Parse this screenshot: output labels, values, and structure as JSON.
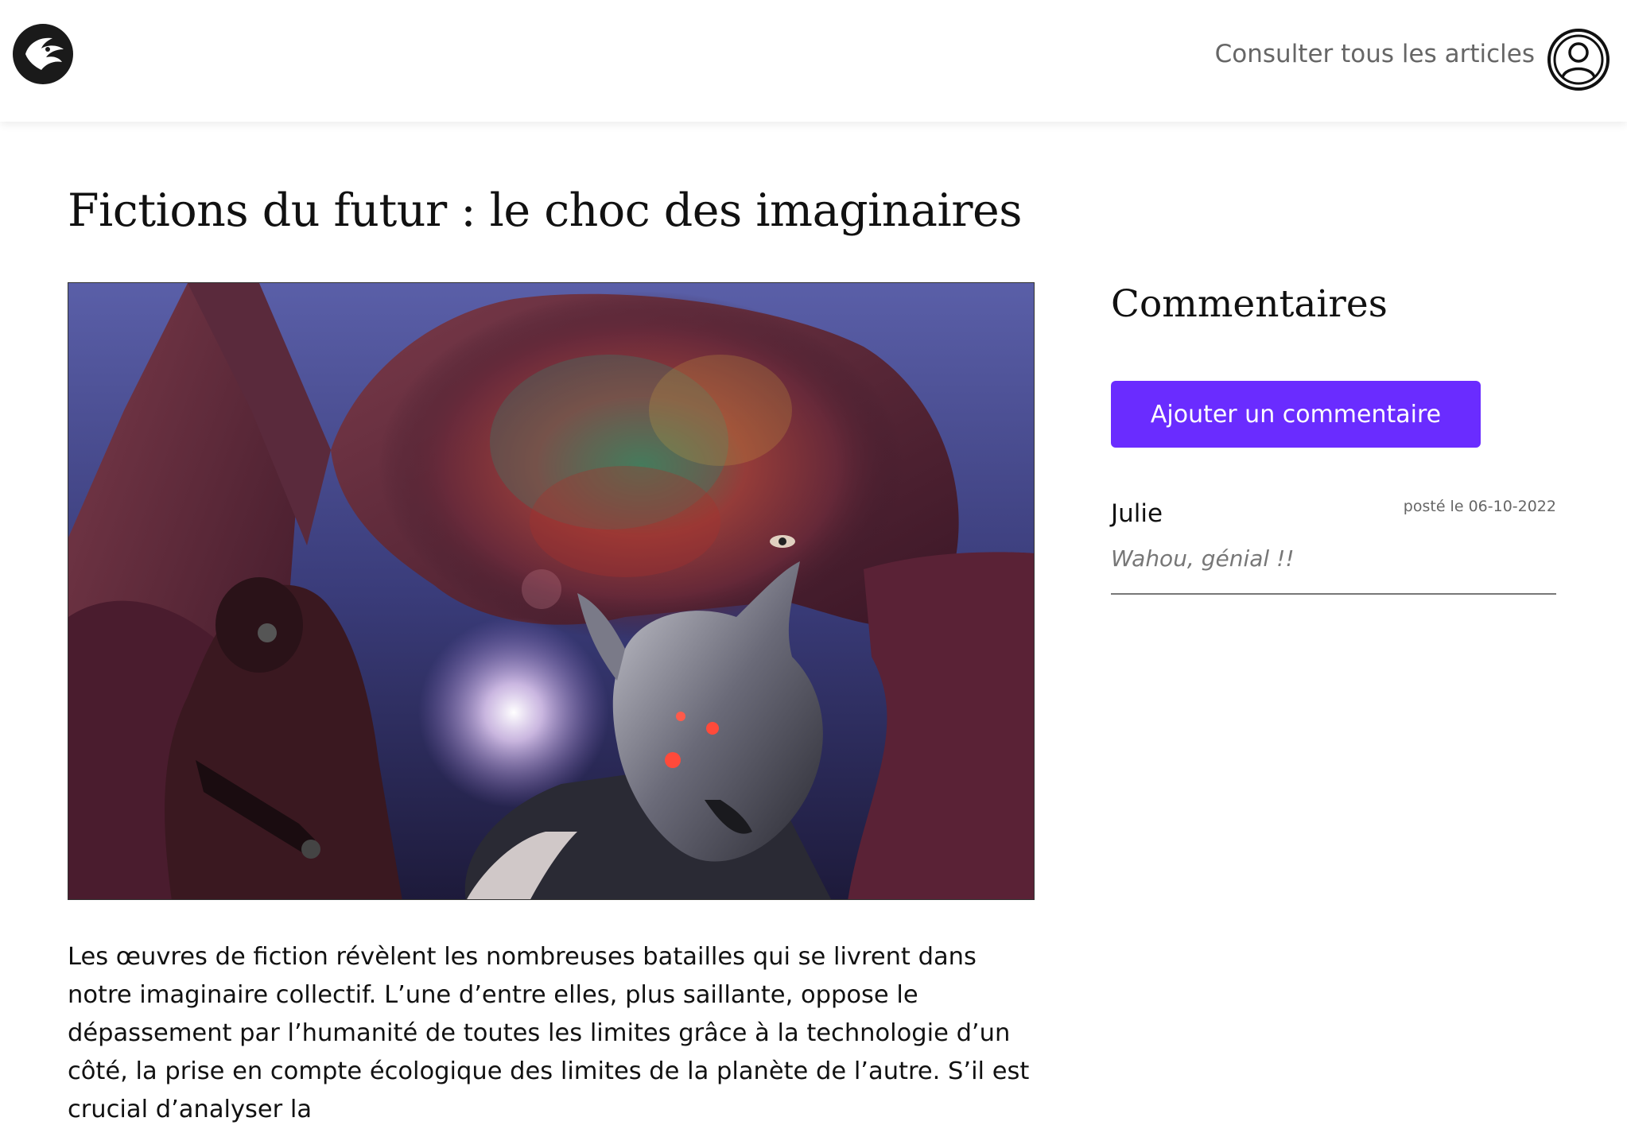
{
  "header": {
    "logo_icon": "phoenix-logo-icon",
    "nav_link": "Consulter tous les articles",
    "account_icon": "user-account-icon"
  },
  "article": {
    "title": "Fictions du futur : le choc des imaginaires",
    "image_icon": "sci-fi-collage-image",
    "body": "Les œuvres de fiction révèlent les nombreuses batailles qui se livrent dans notre imaginaire collectif. L’une d’entre elles, plus saillante, oppose le dépassement par l’humanité de toutes les limites grâce à la technologie d’un côté, la prise en compte écologique des limites de la planète de l’autre. S’il est crucial d’analyser la"
  },
  "comments": {
    "title": "Commentaires",
    "add_button": "Ajouter un commentaire",
    "items": [
      {
        "author": "Julie",
        "date": "posté le 06-10-2022",
        "text": "Wahou, génial !!"
      }
    ]
  },
  "colors": {
    "accent": "#6a2cff",
    "text": "#111111",
    "muted": "#666666"
  }
}
